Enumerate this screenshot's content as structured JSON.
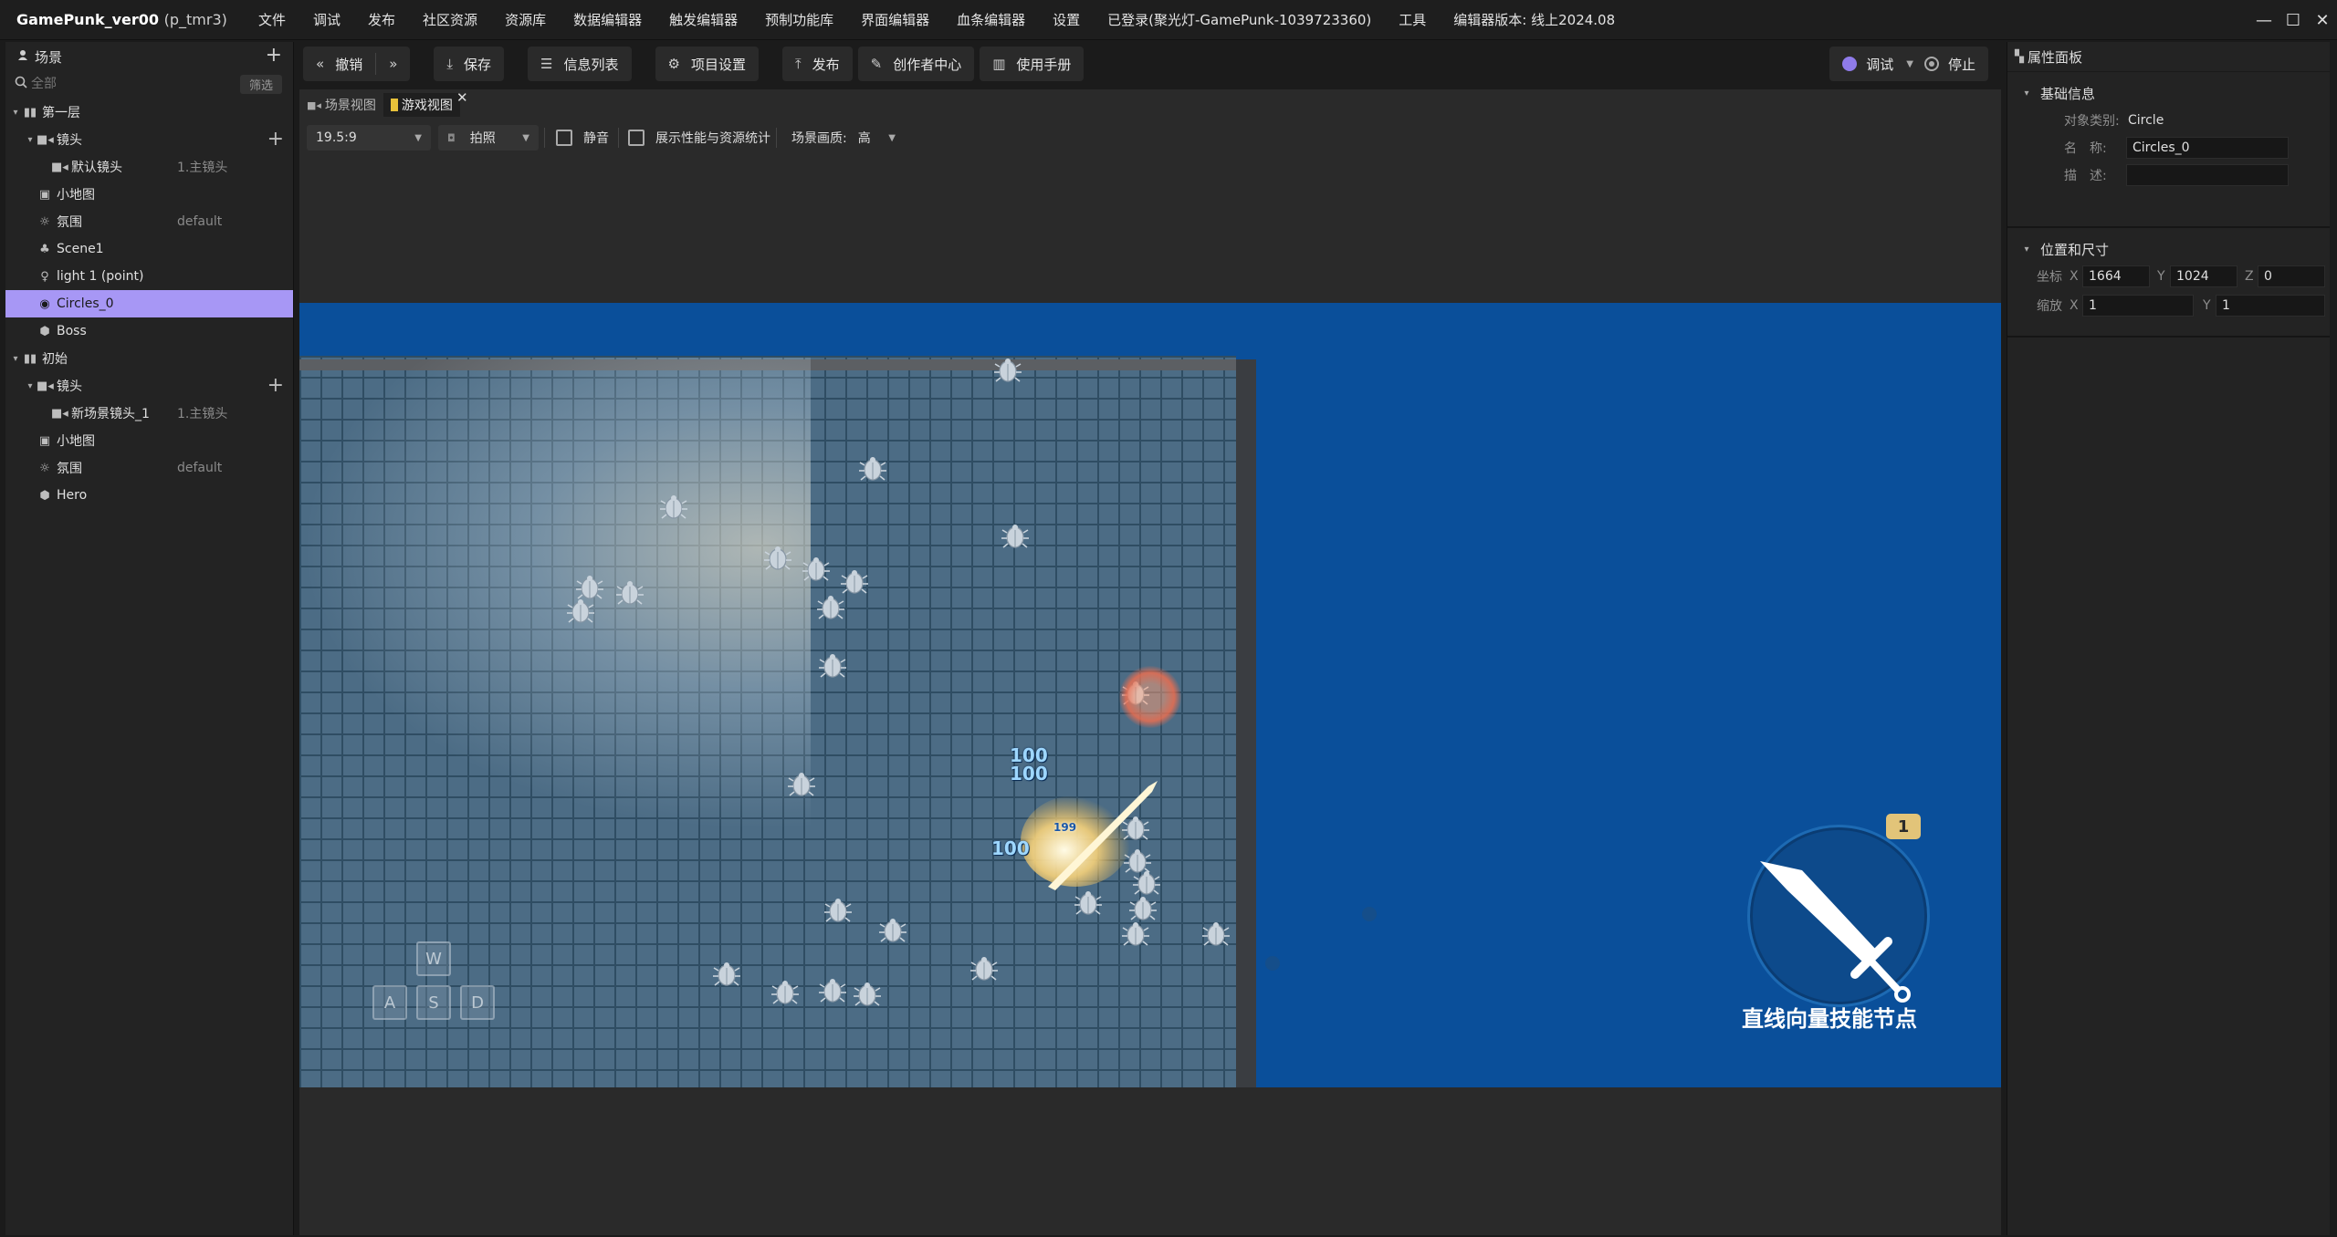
{
  "window": {
    "title": "GamePunk_ver00",
    "subtitle": "(p_tmr3)",
    "controls": [
      "—",
      "☐",
      "✕"
    ]
  },
  "menu": [
    "文件",
    "调试",
    "发布",
    "社区资源",
    "资源库",
    "数据编辑器",
    "触发编辑器",
    "预制功能库",
    "界面编辑器",
    "血条编辑器",
    "设置",
    "已登录(聚光灯-GamePunk-1039723360)",
    "工具",
    "编辑器版本: 线上2024.08"
  ],
  "left_panel": {
    "title": "场景",
    "search_placeholder": "全部",
    "filter_label": "筛选",
    "tree": [
      {
        "label": "第一层",
        "tag": "",
        "level": 0,
        "icon": "layer-icon",
        "caret": "▾"
      },
      {
        "label": "镜头",
        "tag": "",
        "level": 1,
        "icon": "camera-icon",
        "caret": "▾",
        "plus": true
      },
      {
        "label": "默认镜头",
        "tag": "1.主镜头",
        "level": 2,
        "icon": "camera-icon",
        "caret": ""
      },
      {
        "label": "小地图",
        "tag": "",
        "level": 1,
        "icon": "minimap-icon",
        "caret": ""
      },
      {
        "label": "氛围",
        "tag": "default",
        "level": 1,
        "icon": "atmosphere-icon",
        "caret": ""
      },
      {
        "label": "Scene1",
        "tag": "",
        "level": 1,
        "icon": "tree-icon",
        "caret": ""
      },
      {
        "label": "light 1 (point)",
        "tag": "",
        "level": 1,
        "icon": "light-icon",
        "caret": ""
      },
      {
        "label": "Circles_0",
        "tag": "",
        "level": 1,
        "icon": "circle-icon",
        "caret": "",
        "selected": true
      },
      {
        "label": "Boss",
        "tag": "",
        "level": 1,
        "icon": "cube-icon",
        "caret": ""
      },
      {
        "label": "初始",
        "tag": "",
        "level": 0,
        "icon": "layer-icon",
        "caret": "▾"
      },
      {
        "label": "镜头",
        "tag": "",
        "level": 1,
        "icon": "camera-icon",
        "caret": "▾",
        "plus": true
      },
      {
        "label": "新场景镜头_1",
        "tag": "1.主镜头",
        "level": 2,
        "icon": "camera-icon",
        "caret": ""
      },
      {
        "label": "小地图",
        "tag": "",
        "level": 1,
        "icon": "minimap-icon",
        "caret": ""
      },
      {
        "label": "氛围",
        "tag": "default",
        "level": 1,
        "icon": "atmosphere-icon",
        "caret": ""
      },
      {
        "label": "Hero",
        "tag": "",
        "level": 1,
        "icon": "cube-icon",
        "caret": ""
      }
    ]
  },
  "toolbar": {
    "undo": "撤销",
    "save": "保存",
    "info_list": "信息列表",
    "project_settings": "项目设置",
    "publish": "发布",
    "creator_center": "创作者中心",
    "manual": "使用手册",
    "debug": "调试",
    "stop": "停止"
  },
  "tabs": [
    {
      "label": "场景视图",
      "active": false
    },
    {
      "label": "游戏视图",
      "active": true
    }
  ],
  "view_bar": {
    "aspect": "19.5:9",
    "screenshot": "拍照",
    "mute": "静音",
    "show_stats": "展示性能与资源统计",
    "quality_label": "场景画质:",
    "quality_value": "高"
  },
  "game": {
    "damage_numbers": [
      "100",
      "100",
      "100",
      "199"
    ],
    "keys": [
      "W",
      "A",
      "S",
      "D"
    ],
    "skill_badge": "1",
    "skill_label": "直线向量技能节点"
  },
  "right_panel": {
    "title": "属性面板",
    "basic_info": {
      "title": "基础信息",
      "type_label": "对象类别:",
      "type_value": "Circle",
      "name_label": "名　称:",
      "name_value": "Circles_0",
      "desc_label": "描　述:",
      "desc_value": ""
    },
    "transform": {
      "title": "位置和尺寸",
      "position_label": "坐标",
      "pos_x": "1664",
      "pos_y": "1024",
      "pos_z": "0",
      "scale_label": "缩放",
      "scale_x": "1",
      "scale_y": "1"
    }
  },
  "colors": {
    "selection": "#a797f5",
    "game_bg": "#0a4f9a",
    "accent": "#8f7bea"
  }
}
